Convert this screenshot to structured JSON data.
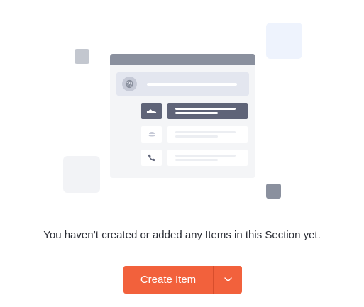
{
  "empty_state": {
    "message": "You haven’t created or added any Items in this Section yet.",
    "create_button_label": "Create Item",
    "dropdown_icon": "chevron-down-icon"
  },
  "illustration": {
    "icons": [
      "globe-icon",
      "shoe-icon",
      "hat-icon",
      "phone-icon"
    ]
  },
  "colors": {
    "accent": "#f2613c",
    "accent_divider": "#d84e2c",
    "text": "#2b2e36",
    "illustration_dark": "#5f6478",
    "illustration_mid": "#8a909e"
  }
}
